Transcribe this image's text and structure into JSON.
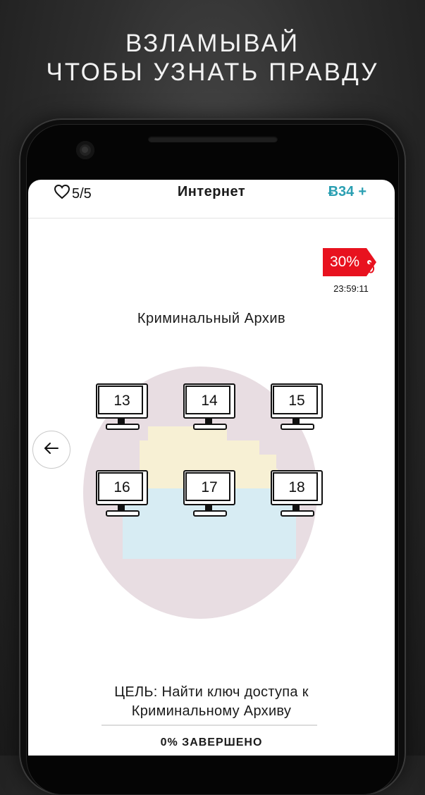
{
  "promo": {
    "line1": "ВЗЛАМЫВАЙ",
    "line2": "ЧТОБЫ УЗНАТЬ ПРАВДУ"
  },
  "header": {
    "lives": "5/5",
    "title": "Интернет",
    "coins": "Ƀ34",
    "add_label": "+"
  },
  "sale": {
    "discount": "30%",
    "timer": "23:59:11",
    "color": "#e8121f"
  },
  "level": {
    "title": "Криминальный Архив"
  },
  "computers": [
    "13",
    "14",
    "15",
    "16",
    "17",
    "18"
  ],
  "goal": {
    "line1": "ЦЕЛЬ: Найти ключ доступа к",
    "line2": "Криминальному Архиву"
  },
  "progress": {
    "label": "0% ЗАВЕРШЕНО",
    "value": 0
  },
  "colors": {
    "accent": "#2a9fb2",
    "circle": "#e8dde2"
  },
  "icons": {
    "lives": "heart-icon",
    "back": "arrow-left-icon",
    "sale": "price-tag-icon"
  }
}
